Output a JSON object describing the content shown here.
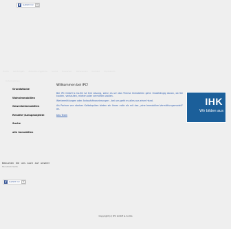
{
  "facebook": {
    "share_label": "Gefällt mir",
    "share_count": "0",
    "share_label_2": "Gefällt mir",
    "share_count_2": "0",
    "brand_letter": "f"
  },
  "nav": {
    "items": [
      "Home",
      "Leistungen",
      "Aktuelle Angebote",
      "Suche",
      "Bewerten",
      "Referenzen",
      "Kontakt",
      "Impressum"
    ],
    "sub": "Unternehmen"
  },
  "sidebar": {
    "items": [
      "Grundstücke",
      "Wohnimmobilien",
      "Gewerbeimmobilien",
      "Rendite-/Anlageobjekte",
      "Suche",
      "alle Immobilien"
    ]
  },
  "main": {
    "heading": "Willkommen bei IPC!",
    "p1": "Bei IPC GmbH & Co.KG ist Ihre Lösung, wenn es um das Thema Immobilien geht. Unabhängig davon, ob Sie kaufen, verkaufen, mieten oder vermieten wollen.",
    "p2": "Wertermittlungen oder Ankaufsfinanzierungen - bei uns geht es alles aus einer Hand.",
    "p3": "Als Partner von starken Kaltakquiten bieten wir Ihnen volle als mit das „eine Immobilien-Vermittlungsmodell\" an.",
    "link": "Das Team"
  },
  "ihk": {
    "title": "IHK",
    "tagline": "Wir bilden aus",
    "color": "#1b5f9a"
  },
  "share": {
    "text": "Besuchen Sie uns auch auf unserer",
    "sub": "Facebook-Seite"
  },
  "footer": {
    "copyright": "Copyright (c) IPC GmbH & Co.KG"
  }
}
